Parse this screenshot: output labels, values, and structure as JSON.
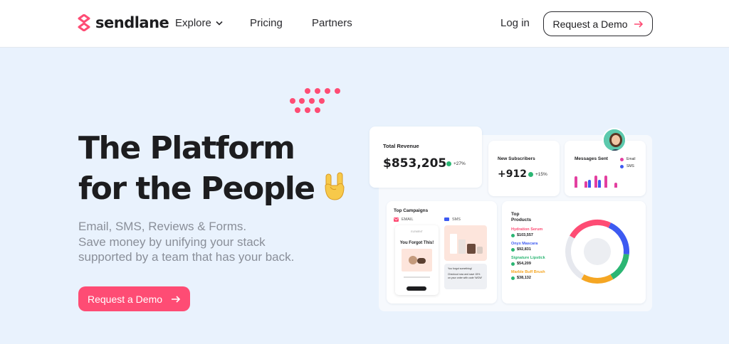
{
  "nav": {
    "brand": "sendlane",
    "explore": "Explore",
    "pricing": "Pricing",
    "partners": "Partners",
    "login": "Log in",
    "demo": "Request a Demo"
  },
  "hero": {
    "title_line1": "The Platform",
    "title_line2": "for the People",
    "sub_line1": "Email, SMS, Reviews & Forms.",
    "sub_line2": "Save money by unifying your stack",
    "sub_line3": "supported by a team that has your back.",
    "cta": "Request a Demo"
  },
  "dashboard": {
    "revenue": {
      "label": "Total Revenue",
      "value": "$853,205",
      "delta": "+27%"
    },
    "subscribers": {
      "label": "New Subscribers",
      "value": "+912",
      "delta": "+15%"
    },
    "messages": {
      "label": "Messages Sent",
      "legend": [
        "Email",
        "SMS"
      ],
      "bars": [
        {
          "email": 0.78,
          "sms": 0.0
        },
        {
          "email": 0.45,
          "sms": 0.55
        },
        {
          "email": 0.85,
          "sms": 0.55
        },
        {
          "email": 0.85,
          "sms": 0.0
        },
        {
          "email": 0.35,
          "sms": 0.0
        }
      ]
    },
    "campaigns": {
      "label": "Top Campaigns",
      "email_tag": "EMAIL",
      "sms_tag": "SMS",
      "email_brand": "ELEMENT",
      "email_heading": "You Forgot This!",
      "sms_text1": "You forgot something!",
      "sms_text2": "Checkout now and save 15% on your order with code 'WOW'"
    },
    "products": {
      "label_line1": "Top",
      "label_line2": "Products",
      "items": [
        {
          "name": "Hydration Serum",
          "value": "$103,557",
          "color": "#fe4c74"
        },
        {
          "name": "Onyx Mascara",
          "value": "$92,831",
          "color": "#3d5af1"
        },
        {
          "name": "Signature Lipstick",
          "value": "$54,209",
          "color": "#2bb673"
        },
        {
          "name": "Marble Buff Brush",
          "value": "$38,132",
          "color": "#f5a623"
        }
      ]
    }
  },
  "colors": {
    "accent": "#fe4c74",
    "email": "#e33fa0",
    "sms": "#3d5af1",
    "dark": "#1d1d1f"
  }
}
